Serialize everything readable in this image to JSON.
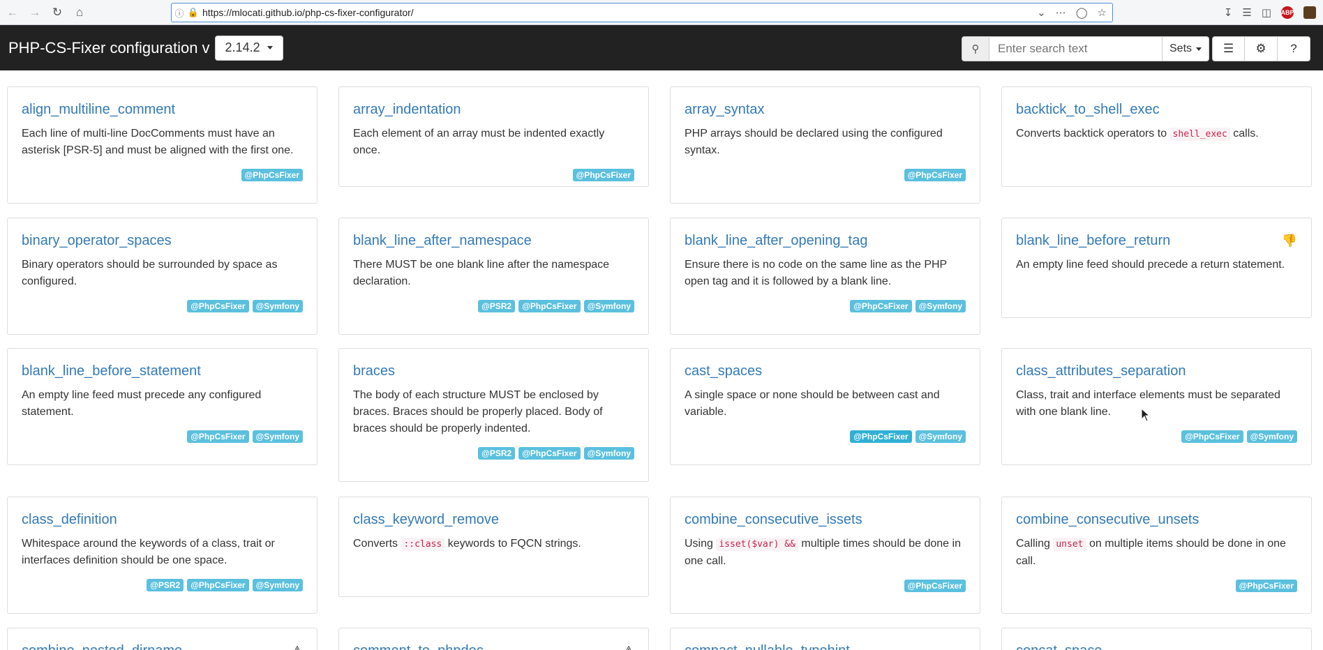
{
  "browser": {
    "url": "https://mlocati.github.io/php-cs-fixer-configurator/"
  },
  "navbar": {
    "brand": "PHP-CS-Fixer configuration v",
    "version": "2.14.2",
    "search_placeholder": "Enter search text",
    "sets_label": "Sets"
  },
  "cards": [
    {
      "title": "align_multiline_comment",
      "desc": "Each line of multi-line DocComments must have an asterisk [PSR-5] and must be aligned with the first one.",
      "badges": [
        "@PhpCsFixer"
      ]
    },
    {
      "title": "array_indentation",
      "desc": "Each element of an array must be indented exactly once.",
      "badges": [
        "@PhpCsFixer"
      ]
    },
    {
      "title": "array_syntax",
      "desc": "PHP arrays should be declared using the configured syntax.",
      "badges": [
        "@PhpCsFixer"
      ]
    },
    {
      "title": "backtick_to_shell_exec",
      "desc_parts": [
        "Converts backtick operators to ",
        "shell_exec",
        " calls."
      ],
      "badges": []
    },
    {
      "title": "binary_operator_spaces",
      "desc": "Binary operators should be surrounded by space as configured.",
      "badges": [
        "@PhpCsFixer",
        "@Symfony"
      ]
    },
    {
      "title": "blank_line_after_namespace",
      "desc": "There MUST be one blank line after the namespace declaration.",
      "badges": [
        "@PSR2",
        "@PhpCsFixer",
        "@Symfony"
      ]
    },
    {
      "title": "blank_line_after_opening_tag",
      "desc": "Ensure there is no code on the same line as the PHP open tag and it is followed by a blank line.",
      "badges": [
        "@PhpCsFixer",
        "@Symfony"
      ]
    },
    {
      "title": "blank_line_before_return",
      "desc": "An empty line feed should precede a return statement.",
      "badges": [],
      "icon": "thumbs-down-icon"
    },
    {
      "title": "blank_line_before_statement",
      "desc": "An empty line feed must precede any configured statement.",
      "badges": [
        "@PhpCsFixer",
        "@Symfony"
      ]
    },
    {
      "title": "braces",
      "desc": "The body of each structure MUST be enclosed by braces. Braces should be properly placed. Body of braces should be properly indented.",
      "badges": [
        "@PSR2",
        "@PhpCsFixer",
        "@Symfony"
      ]
    },
    {
      "title": "cast_spaces",
      "desc": "A single space or none should be between cast and variable.",
      "badges": [
        "@PhpCsFixer",
        "@Symfony"
      ]
    },
    {
      "title": "class_attributes_separation",
      "desc": "Class, trait and interface elements must be separated with one blank line.",
      "badges": [
        "@PhpCsFixer",
        "@Symfony"
      ]
    },
    {
      "title": "class_definition",
      "desc": "Whitespace around the keywords of a class, trait or interfaces definition should be one space.",
      "badges": [
        "@PSR2",
        "@PhpCsFixer",
        "@Symfony"
      ]
    },
    {
      "title": "class_keyword_remove",
      "desc_parts": [
        "Converts ",
        "::class",
        " keywords to FQCN strings."
      ],
      "badges": []
    },
    {
      "title": "combine_consecutive_issets",
      "desc_parts": [
        "Using ",
        "isset($var) &&",
        " multiple times should be done in one call."
      ],
      "badges": [
        "@PhpCsFixer"
      ]
    },
    {
      "title": "combine_consecutive_unsets",
      "desc_parts": [
        "Calling ",
        "unset",
        " on multiple items should be done in one call."
      ],
      "badges": [
        "@PhpCsFixer"
      ]
    },
    {
      "title": "combine_nested_dirname",
      "badges": [],
      "icon": "warning-icon"
    },
    {
      "title": "comment_to_phpdoc",
      "badges": [],
      "icon": "warning-icon"
    },
    {
      "title": "compact_nullable_typehint",
      "badges": []
    },
    {
      "title": "concat_space",
      "badges": []
    }
  ]
}
